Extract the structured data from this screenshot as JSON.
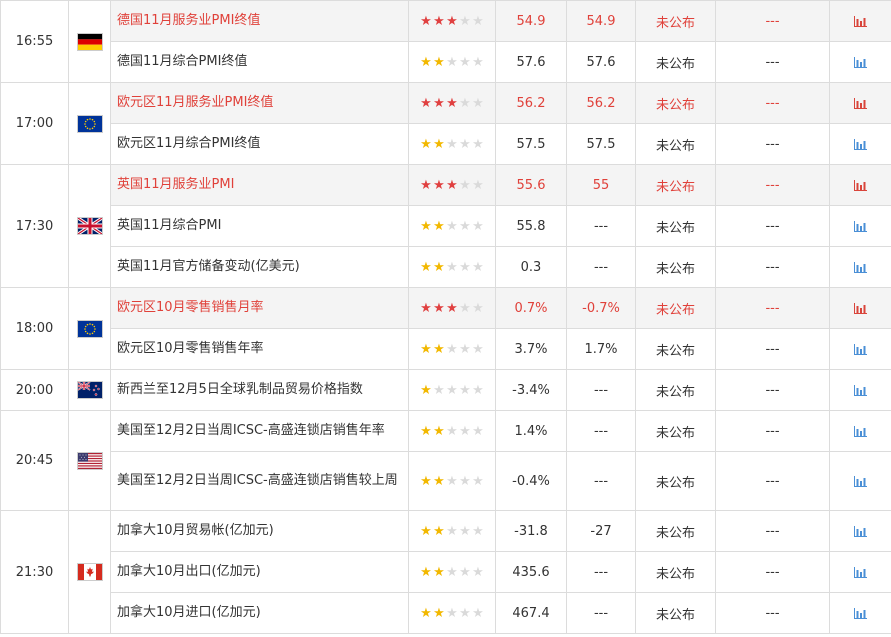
{
  "colors": {
    "important": "#e0413a",
    "star_red": "#e04040",
    "star_yellow": "#f2b800",
    "chart_blue": "#4a8fd6",
    "chart_red": "#d9443a"
  },
  "icons": {
    "star": "star-icon",
    "chart": "bar-chart-icon"
  },
  "groups": [
    {
      "time": "16:55",
      "flag": "germany",
      "rows": [
        {
          "name": "德国11月服务业PMI终值",
          "stars": 3,
          "previous": "54.9",
          "forecast": "54.9",
          "actual": "未公布",
          "impact": "---",
          "important": true
        },
        {
          "name": "德国11月综合PMI终值",
          "stars": 2,
          "previous": "57.6",
          "forecast": "57.6",
          "actual": "未公布",
          "impact": "---",
          "important": false
        }
      ]
    },
    {
      "time": "17:00",
      "flag": "eu",
      "rows": [
        {
          "name": "欧元区11月服务业PMI终值",
          "stars": 3,
          "previous": "56.2",
          "forecast": "56.2",
          "actual": "未公布",
          "impact": "---",
          "important": true
        },
        {
          "name": "欧元区11月综合PMI终值",
          "stars": 2,
          "previous": "57.5",
          "forecast": "57.5",
          "actual": "未公布",
          "impact": "---",
          "important": false
        }
      ]
    },
    {
      "time": "17:30",
      "flag": "uk",
      "rows": [
        {
          "name": "英国11月服务业PMI",
          "stars": 3,
          "previous": "55.6",
          "forecast": "55",
          "actual": "未公布",
          "impact": "---",
          "important": true
        },
        {
          "name": "英国11月综合PMI",
          "stars": 2,
          "previous": "55.8",
          "forecast": "---",
          "actual": "未公布",
          "impact": "---",
          "important": false
        },
        {
          "name": "英国11月官方储备变动(亿美元)",
          "stars": 2,
          "previous": "0.3",
          "forecast": "---",
          "actual": "未公布",
          "impact": "---",
          "important": false
        }
      ]
    },
    {
      "time": "18:00",
      "flag": "eu",
      "rows": [
        {
          "name": "欧元区10月零售销售月率",
          "stars": 3,
          "previous": "0.7%",
          "forecast": "-0.7%",
          "actual": "未公布",
          "impact": "---",
          "important": true
        },
        {
          "name": "欧元区10月零售销售年率",
          "stars": 2,
          "previous": "3.7%",
          "forecast": "1.7%",
          "actual": "未公布",
          "impact": "---",
          "important": false
        }
      ]
    },
    {
      "time": "20:00",
      "flag": "nz",
      "rows": [
        {
          "name": "新西兰至12月5日全球乳制品贸易价格指数",
          "stars": 1,
          "previous": "-3.4%",
          "forecast": "---",
          "actual": "未公布",
          "impact": "---",
          "important": false
        }
      ]
    },
    {
      "time": "20:45",
      "flag": "us",
      "rows": [
        {
          "name": "美国至12月2日当周ICSC-高盛连锁店销售年率",
          "stars": 2,
          "previous": "1.4%",
          "forecast": "---",
          "actual": "未公布",
          "impact": "---",
          "important": false
        },
        {
          "name": "美国至12月2日当周ICSC-高盛连锁店销售较上周",
          "stars": 2,
          "previous": "-0.4%",
          "forecast": "---",
          "actual": "未公布",
          "impact": "---",
          "important": false,
          "tall": true
        }
      ]
    },
    {
      "time": "21:30",
      "flag": "ca",
      "rows": [
        {
          "name": "加拿大10月贸易帐(亿加元)",
          "stars": 2,
          "previous": "-31.8",
          "forecast": "-27",
          "actual": "未公布",
          "impact": "---",
          "important": false
        },
        {
          "name": "加拿大10月出口(亿加元)",
          "stars": 2,
          "previous": "435.6",
          "forecast": "---",
          "actual": "未公布",
          "impact": "---",
          "important": false
        },
        {
          "name": "加拿大10月进口(亿加元)",
          "stars": 2,
          "previous": "467.4",
          "forecast": "---",
          "actual": "未公布",
          "impact": "---",
          "important": false
        }
      ]
    }
  ]
}
